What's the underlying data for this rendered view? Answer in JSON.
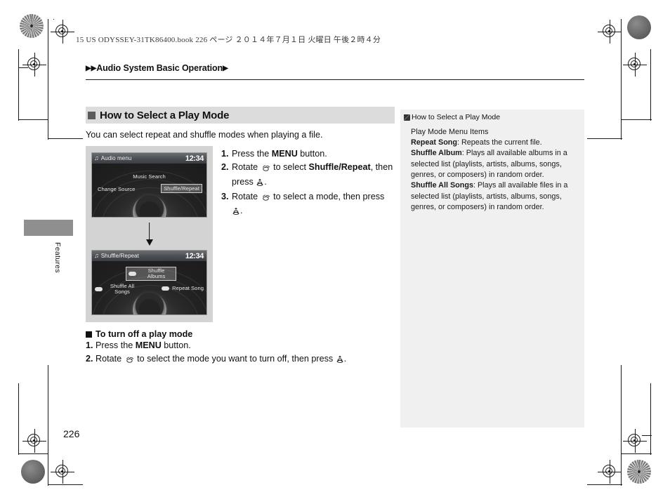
{
  "print": {
    "slug": "15 US ODYSSEY-31TK86400.book   226 ページ   ２０１４年７月１日   火曜日   午後２時４分",
    "page_number": "226",
    "side_tab_label": "Features"
  },
  "running_head": {
    "prefix": "▶▶",
    "title": "Audio System Basic Operation",
    "suffix": "▶"
  },
  "section": {
    "heading": "How to Select a Play Mode",
    "intro": "You can select repeat and shuffle modes when playing a file.",
    "steps": [
      {
        "num": "1.",
        "parts": [
          {
            "t": "Press the "
          },
          {
            "t": "MENU",
            "b": true
          },
          {
            "t": " button."
          }
        ]
      },
      {
        "num": "2.",
        "parts": [
          {
            "t": "Rotate "
          },
          {
            "icon": "rotary-knob-icon"
          },
          {
            "t": " to select "
          },
          {
            "t": "Shuffle/Repeat",
            "b": true
          },
          {
            "t": ", then press "
          },
          {
            "icon": "press-knob-icon"
          },
          {
            "t": "."
          }
        ]
      },
      {
        "num": "3.",
        "parts": [
          {
            "t": "Rotate "
          },
          {
            "icon": "rotary-knob-icon"
          },
          {
            "t": " to select a mode, then press "
          },
          {
            "icon": "press-knob-icon"
          },
          {
            "t": "."
          }
        ]
      }
    ]
  },
  "subsection": {
    "heading": "To turn off a play mode",
    "steps": [
      {
        "num": "1.",
        "parts": [
          {
            "t": "Press the "
          },
          {
            "t": "MENU",
            "b": true
          },
          {
            "t": " button."
          }
        ]
      },
      {
        "num": "2.",
        "parts": [
          {
            "t": "Rotate "
          },
          {
            "icon": "rotary-knob-icon"
          },
          {
            "t": " to select the mode you want to turn off, then press "
          },
          {
            "icon": "press-knob-icon"
          },
          {
            "t": "."
          }
        ]
      }
    ]
  },
  "figure": {
    "screen_one": {
      "title": "Audio menu",
      "clock": "12:34",
      "center_label": "Music Search",
      "left_label": "Change Source",
      "right_label": "Shuffle/Repeat"
    },
    "arrow": "↓",
    "screen_two": {
      "title": "Shuffle/Repeat",
      "clock": "12:34",
      "top_label": "Shuffle Albums",
      "left_label": "Shuffle All Songs",
      "right_label": "Repeat Song"
    }
  },
  "sidebar": {
    "heading": "How to Select a Play Mode",
    "subtitle": "Play Mode Menu Items",
    "entries": [
      {
        "term": "Repeat Song",
        "desc": ": Repeats the current file."
      },
      {
        "term": "Shuffle Album",
        "desc": ": Plays all available albums in a selected list (playlists, artists, albums, songs, genres, or composers) in random order."
      },
      {
        "term": "Shuffle All Songs",
        "desc": ": Plays all available files in a selected list (playlists, artists, albums, songs, genres, or composers) in random order."
      }
    ]
  },
  "colors": {
    "heading_bar": "#dcdcdc",
    "sidebar_bg": "#f0f0f0",
    "figure_bg": "#d3d3d3",
    "screen_bg": "#1d1d1d",
    "tab": "#8f8f8f"
  }
}
